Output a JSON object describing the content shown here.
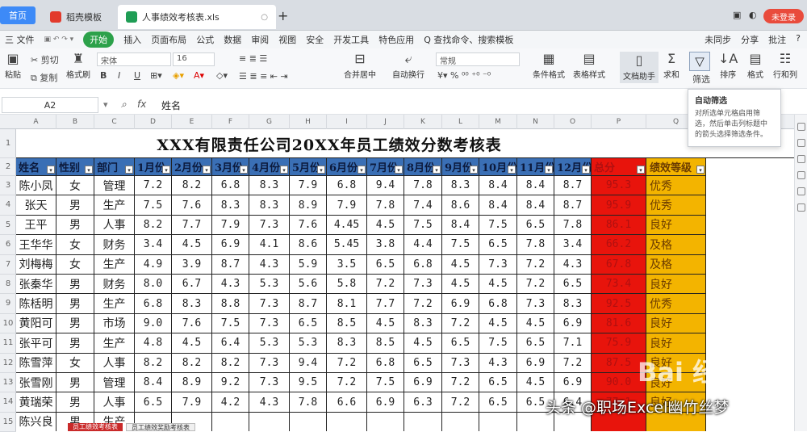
{
  "tabs": {
    "home": "首页",
    "tab2": "稻壳模板",
    "tab3": "人事绩效考核表.xls",
    "plus": "+",
    "login": "未登录"
  },
  "menu": {
    "items": [
      "三 文件",
      "开始",
      "插入",
      "页面布局",
      "公式",
      "数据",
      "审阅",
      "视图",
      "安全",
      "开发工具",
      "特色应用",
      "Q 查找命令、搜索模板"
    ],
    "active_index": 1,
    "right": [
      "未同步",
      "分享",
      "批注"
    ]
  },
  "ribbon": {
    "paste": "粘贴",
    "cut": "剪切",
    "copy": "复制",
    "format_painter": "格式刷",
    "font": "宋体",
    "font_size": "16",
    "bold": "B",
    "italic": "I",
    "underline": "U",
    "merge": "合并居中",
    "wrap": "自动换行",
    "number_format": "常规",
    "cond_format": "条件格式",
    "table_style": "表格样式",
    "doc_assist": "文档助手",
    "sum": "求和",
    "filter": "筛选",
    "sort": "排序",
    "format": "格式",
    "row_col": "行和列",
    "sum_glyph": "Σ",
    "filter_glyph": "▽",
    "sort_glyph": "↓A",
    "format_glyph": "▤",
    "rowcol_glyph": "☷"
  },
  "formula_bar": {
    "name_box": "A2",
    "fx": "fx",
    "value": "姓名"
  },
  "tooltip": {
    "title": "自动筛选",
    "desc": "对所选单元格启用筛选，然后单击列标题中的箭头选择筛选条件。"
  },
  "sheet": {
    "col_letters": [
      "A",
      "B",
      "C",
      "D",
      "E",
      "F",
      "G",
      "H",
      "I",
      "J",
      "K",
      "L",
      "M",
      "N",
      "O",
      "P",
      "Q"
    ],
    "row_numbers": [
      "1",
      "2",
      "3",
      "4",
      "5",
      "6",
      "7",
      "8",
      "9",
      "10",
      "11",
      "12",
      "13",
      "14",
      "15"
    ],
    "title": "XXX有限责任公司20XX年员工绩效分数考核表",
    "headers": [
      "姓名",
      "性别",
      "部门",
      "1月份",
      "2月份",
      "3月份",
      "4月份",
      "5月份",
      "6月份",
      "7月份",
      "8月份",
      "9月份",
      "10月份",
      "11月份",
      "12月份",
      "总分",
      "绩效等级"
    ],
    "rows": [
      [
        "陈小凤",
        "女",
        "管理",
        "7.2",
        "8.2",
        "6.8",
        "8.3",
        "7.9",
        "6.8",
        "9.4",
        "7.8",
        "8.3",
        "8.4",
        "8.4",
        "8.7",
        "95.3",
        "优秀"
      ],
      [
        "张天",
        "男",
        "生产",
        "7.5",
        "7.6",
        "8.3",
        "8.3",
        "8.9",
        "7.9",
        "7.8",
        "7.4",
        "8.6",
        "8.4",
        "8.4",
        "8.7",
        "95.9",
        "优秀"
      ],
      [
        "王平",
        "男",
        "人事",
        "8.2",
        "7.7",
        "7.9",
        "7.3",
        "7.6",
        "4.45",
        "4.5",
        "7.5",
        "8.4",
        "7.5",
        "6.5",
        "7.8",
        "86.1",
        "良好"
      ],
      [
        "王华华",
        "女",
        "财务",
        "3.4",
        "4.5",
        "6.9",
        "4.1",
        "8.6",
        "5.45",
        "3.8",
        "4.4",
        "7.5",
        "6.5",
        "7.8",
        "3.4",
        "66.2",
        "及格"
      ],
      [
        "刘梅梅",
        "女",
        "生产",
        "4.9",
        "3.9",
        "8.7",
        "4.3",
        "5.9",
        "3.5",
        "6.5",
        "6.8",
        "4.5",
        "7.3",
        "7.2",
        "4.3",
        "67.8",
        "及格"
      ],
      [
        "张秦华",
        "男",
        "财务",
        "8.0",
        "6.7",
        "4.3",
        "5.3",
        "5.6",
        "5.8",
        "7.2",
        "7.3",
        "4.5",
        "4.5",
        "7.2",
        "6.5",
        "73.4",
        "良好"
      ],
      [
        "陈栝明",
        "男",
        "生产",
        "6.8",
        "8.3",
        "8.8",
        "7.3",
        "8.7",
        "8.1",
        "7.7",
        "7.2",
        "6.9",
        "6.8",
        "7.3",
        "8.3",
        "92.5",
        "优秀"
      ],
      [
        "黄阳可",
        "男",
        "市场",
        "9.0",
        "7.6",
        "7.5",
        "7.3",
        "6.5",
        "8.5",
        "4.5",
        "8.3",
        "7.2",
        "4.5",
        "4.5",
        "6.9",
        "81.6",
        "良好"
      ],
      [
        "张平可",
        "男",
        "生产",
        "4.8",
        "4.5",
        "6.4",
        "5.3",
        "5.3",
        "8.3",
        "8.5",
        "4.5",
        "6.5",
        "7.5",
        "6.5",
        "7.1",
        "75.9",
        "良好"
      ],
      [
        "陈雪萍",
        "女",
        "人事",
        "8.2",
        "8.2",
        "8.2",
        "7.3",
        "9.4",
        "7.2",
        "6.8",
        "6.5",
        "7.3",
        "4.3",
        "6.9",
        "7.2",
        "87.5",
        "良好"
      ],
      [
        "张雪刚",
        "男",
        "管理",
        "8.4",
        "8.9",
        "9.2",
        "7.3",
        "9.5",
        "7.2",
        "7.5",
        "6.9",
        "7.2",
        "6.5",
        "4.5",
        "6.9",
        "90.0",
        "良好"
      ],
      [
        "黄瑞荣",
        "男",
        "人事",
        "6.5",
        "7.9",
        "4.2",
        "4.3",
        "7.8",
        "6.6",
        "6.9",
        "6.3",
        "7.2",
        "6.5",
        "6.5",
        "6.4",
        "77.1",
        "良好"
      ],
      [
        "陈兴良",
        "男",
        "生产",
        "",
        "",
        "",
        "",
        "",
        "",
        "",
        "",
        "",
        "",
        "",
        "",
        "",
        ""
      ]
    ]
  },
  "sheet_tabs": [
    "员工绩效考核表",
    "员工绩效奖励考核表"
  ],
  "watermarks": {
    "baidu": "Bai 经验",
    "author": "头条 @职场Excel幽竹丝梦"
  },
  "colors": {
    "header_blue": "#3a6fb5",
    "score_red": "#e8140c",
    "grade_orange": "#f3b400",
    "accent_green": "#2ca14a"
  }
}
